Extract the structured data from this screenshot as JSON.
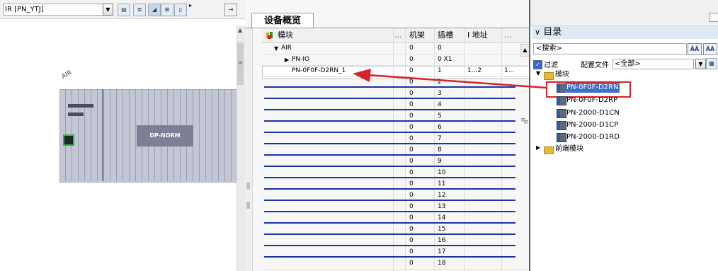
{
  "colors": {
    "accent_red": "#d6222a",
    "empty_slot_line": "#1c33a3",
    "rack": "#c3c6d5",
    "module": "#7c7f95",
    "selection_bg": "#3d6fcb"
  },
  "left": {
    "device_select": "IR [PN_YTJ]",
    "station_label": "AIR",
    "module_label": "DP-NORM"
  },
  "overview": {
    "tab_label": "设备概览",
    "columns": {
      "module": "模块",
      "more1": "...",
      "rack": "机架",
      "slot": "插槽",
      "address": "I 地址",
      "more2": "..."
    },
    "rows": [
      {
        "module": "AIR",
        "rack": "0",
        "slot": "0",
        "addr": "",
        "more": "",
        "expander": "▼",
        "indent": 1,
        "blue": false
      },
      {
        "module": "PN-IO",
        "rack": "0",
        "slot": "0 X1",
        "addr": "",
        "more": "",
        "expander": "▶",
        "indent": 2,
        "blue": false
      },
      {
        "module": "PN-0F0F-D2RN_1",
        "rack": "0",
        "slot": "1",
        "addr": "1...2",
        "more": "1...",
        "expander": "",
        "indent": 2,
        "blue": false
      },
      {
        "module": "",
        "rack": "0",
        "slot": "2",
        "addr": "",
        "more": "",
        "expander": "",
        "indent": 0,
        "blue": true
      },
      {
        "module": "",
        "rack": "0",
        "slot": "3",
        "addr": "",
        "more": "",
        "expander": "",
        "indent": 0,
        "blue": true
      },
      {
        "module": "",
        "rack": "0",
        "slot": "4",
        "addr": "",
        "more": "",
        "expander": "",
        "indent": 0,
        "blue": true
      },
      {
        "module": "",
        "rack": "0",
        "slot": "5",
        "addr": "",
        "more": "",
        "expander": "",
        "indent": 0,
        "blue": true
      },
      {
        "module": "",
        "rack": "0",
        "slot": "6",
        "addr": "",
        "more": "",
        "expander": "",
        "indent": 0,
        "blue": true
      },
      {
        "module": "",
        "rack": "0",
        "slot": "7",
        "addr": "",
        "more": "",
        "expander": "",
        "indent": 0,
        "blue": true
      },
      {
        "module": "",
        "rack": "0",
        "slot": "8",
        "addr": "",
        "more": "",
        "expander": "",
        "indent": 0,
        "blue": true
      },
      {
        "module": "",
        "rack": "0",
        "slot": "9",
        "addr": "",
        "more": "",
        "expander": "",
        "indent": 0,
        "blue": true
      },
      {
        "module": "",
        "rack": "0",
        "slot": "10",
        "addr": "",
        "more": "",
        "expander": "",
        "indent": 0,
        "blue": true
      },
      {
        "module": "",
        "rack": "0",
        "slot": "11",
        "addr": "",
        "more": "",
        "expander": "",
        "indent": 0,
        "blue": true
      },
      {
        "module": "",
        "rack": "0",
        "slot": "12",
        "addr": "",
        "more": "",
        "expander": "",
        "indent": 0,
        "blue": true
      },
      {
        "module": "",
        "rack": "0",
        "slot": "13",
        "addr": "",
        "more": "",
        "expander": "",
        "indent": 0,
        "blue": true
      },
      {
        "module": "",
        "rack": "0",
        "slot": "14",
        "addr": "",
        "more": "",
        "expander": "",
        "indent": 0,
        "blue": true
      },
      {
        "module": "",
        "rack": "0",
        "slot": "15",
        "addr": "",
        "more": "",
        "expander": "",
        "indent": 0,
        "blue": true
      },
      {
        "module": "",
        "rack": "0",
        "slot": "16",
        "addr": "",
        "more": "",
        "expander": "",
        "indent": 0,
        "blue": true
      },
      {
        "module": "",
        "rack": "0",
        "slot": "17",
        "addr": "",
        "more": "",
        "expander": "",
        "indent": 0,
        "blue": true
      },
      {
        "module": "",
        "rack": "0",
        "slot": "18",
        "addr": "",
        "more": "",
        "expander": "",
        "indent": 0,
        "blue": false
      }
    ]
  },
  "catalog": {
    "header": "目录",
    "header_arrow": "∨",
    "search_placeholder": "<搜索>",
    "filter_label": "过滤",
    "profile_label": "配置文件",
    "profile_value": "<全部>",
    "tree": {
      "folder_modules": "模块",
      "items": [
        "PN-0F0F-D2RN",
        "PN-0F0F-D2RP",
        "PN-2000-D1CN",
        "PN-2000-D1CP",
        "PN-2000-D1RD"
      ],
      "folder_frontend": "前端模块"
    }
  }
}
